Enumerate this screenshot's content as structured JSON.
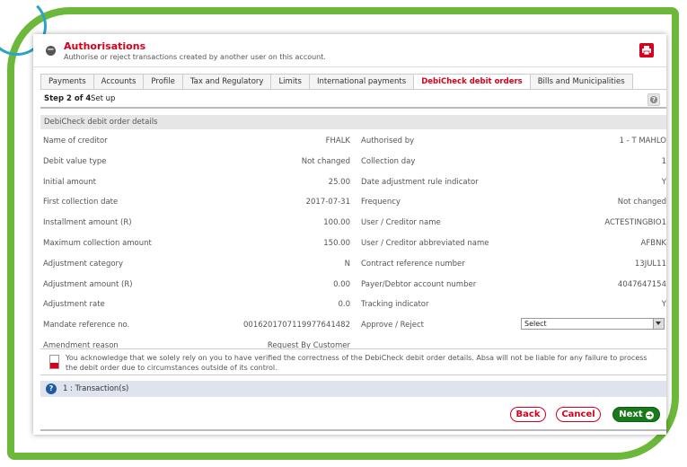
{
  "header": {
    "title": "Authorisations",
    "subtitle": "Authorise or reject transactions created by another user on this account."
  },
  "tabs": [
    {
      "label": "Payments"
    },
    {
      "label": "Accounts"
    },
    {
      "label": "Profile"
    },
    {
      "label": "Tax and Regulatory"
    },
    {
      "label": "Limits"
    },
    {
      "label": "International payments"
    },
    {
      "label": "DebiCheck debit orders",
      "active": true
    },
    {
      "label": "Bills and Municipalities"
    }
  ],
  "step": {
    "bold": "Step 2 of 4",
    "text": "Set up"
  },
  "section_title": "DebiCheck debit order details",
  "rows": [
    {
      "l1": "Name of creditor",
      "v1": "FHALK",
      "l2": "Authorised by",
      "v2": "1 - T MAHLO"
    },
    {
      "l1": "Debit value type",
      "v1": "Not changed",
      "l2": "Collection day",
      "v2": "1"
    },
    {
      "l1": "Initial amount",
      "v1": "25.00",
      "l2": "Date adjustment rule indicator",
      "v2": "Y"
    },
    {
      "l1": "First collection date",
      "v1": "2017-07-31",
      "l2": "Frequency",
      "v2": "Not changed"
    },
    {
      "l1": "Installment amount (R)",
      "v1": "100.00",
      "l2": "User / Creditor name",
      "v2": "ACTESTINGBIO1"
    },
    {
      "l1": "Maximum collection amount",
      "v1": "150.00",
      "l2": "User / Creditor abbreviated name",
      "v2": "AFBNK"
    },
    {
      "l1": "Adjustment category",
      "v1": "N",
      "l2": "Contract reference number",
      "v2": "13JUL11"
    },
    {
      "l1": "Adjustment amount (R)",
      "v1": "0.00",
      "l2": "Payer/Debtor account number",
      "v2": "4047647154"
    },
    {
      "l1": "Adjustment rate",
      "v1": "0.0",
      "l2": "Tracking indicator",
      "v2": "Y"
    },
    {
      "l1": "Mandate reference no.",
      "v1": "00162017071199776414​82",
      "l2": "Approve / Reject",
      "v2": ""
    },
    {
      "l1": "Amendment reason",
      "v1": "Request By Customer",
      "l2": "",
      "v2": ""
    }
  ],
  "approve_select": {
    "value": "Select"
  },
  "acknowledgement": "You acknowledge that we solely rely on you to have verified the correctness of the DebiCheck debit order details. Absa will not be liable for any failure to process the debit order due to circumstances outside of its control.",
  "transactions": "1 : Transaction(s)",
  "buttons": {
    "back": "Back",
    "cancel": "Cancel",
    "next": "Next"
  },
  "colors": {
    "brand_red": "#d6001c",
    "frame_green": "#6cb83a",
    "next_green": "#1a7a1a"
  },
  "icons": {
    "collapse": "minus-circle-icon",
    "print": "printer-icon",
    "help": "question-icon",
    "next": "arrow-right-circle-icon"
  }
}
